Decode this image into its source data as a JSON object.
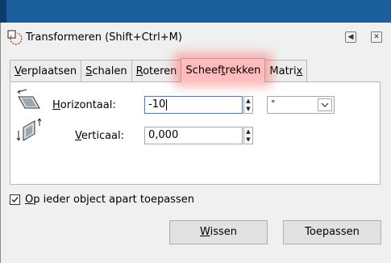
{
  "dialog": {
    "title": "Transformeren (Shift+Ctrl+M)"
  },
  "tabs": [
    {
      "pre": "",
      "u": "V",
      "post": "erplaatsen"
    },
    {
      "pre": "",
      "u": "S",
      "post": "chalen"
    },
    {
      "pre": "",
      "u": "R",
      "post": "oteren"
    },
    {
      "pre": "Scheef",
      "u": "t",
      "post": "rekken"
    },
    {
      "pre": "Matri",
      "u": "x",
      "post": ""
    }
  ],
  "horizontal": {
    "label_u": "H",
    "label_rest": "orizontaal:",
    "value": "-10"
  },
  "vertical": {
    "label_u": "V",
    "label_rest": "erticaal:",
    "value": "0,000"
  },
  "unit_select": {
    "value": "°"
  },
  "apply_separately": {
    "label_u": "O",
    "label_rest": "p ieder object apart toepassen",
    "checked": true
  },
  "buttons": {
    "clear": {
      "u": "W",
      "rest": "issen"
    },
    "apply": {
      "label": "Toepassen"
    }
  },
  "colors": {
    "focus_border": "#3b7ddd",
    "highlight": "#ff3c3c",
    "top_strip": "#1b5e9e"
  }
}
